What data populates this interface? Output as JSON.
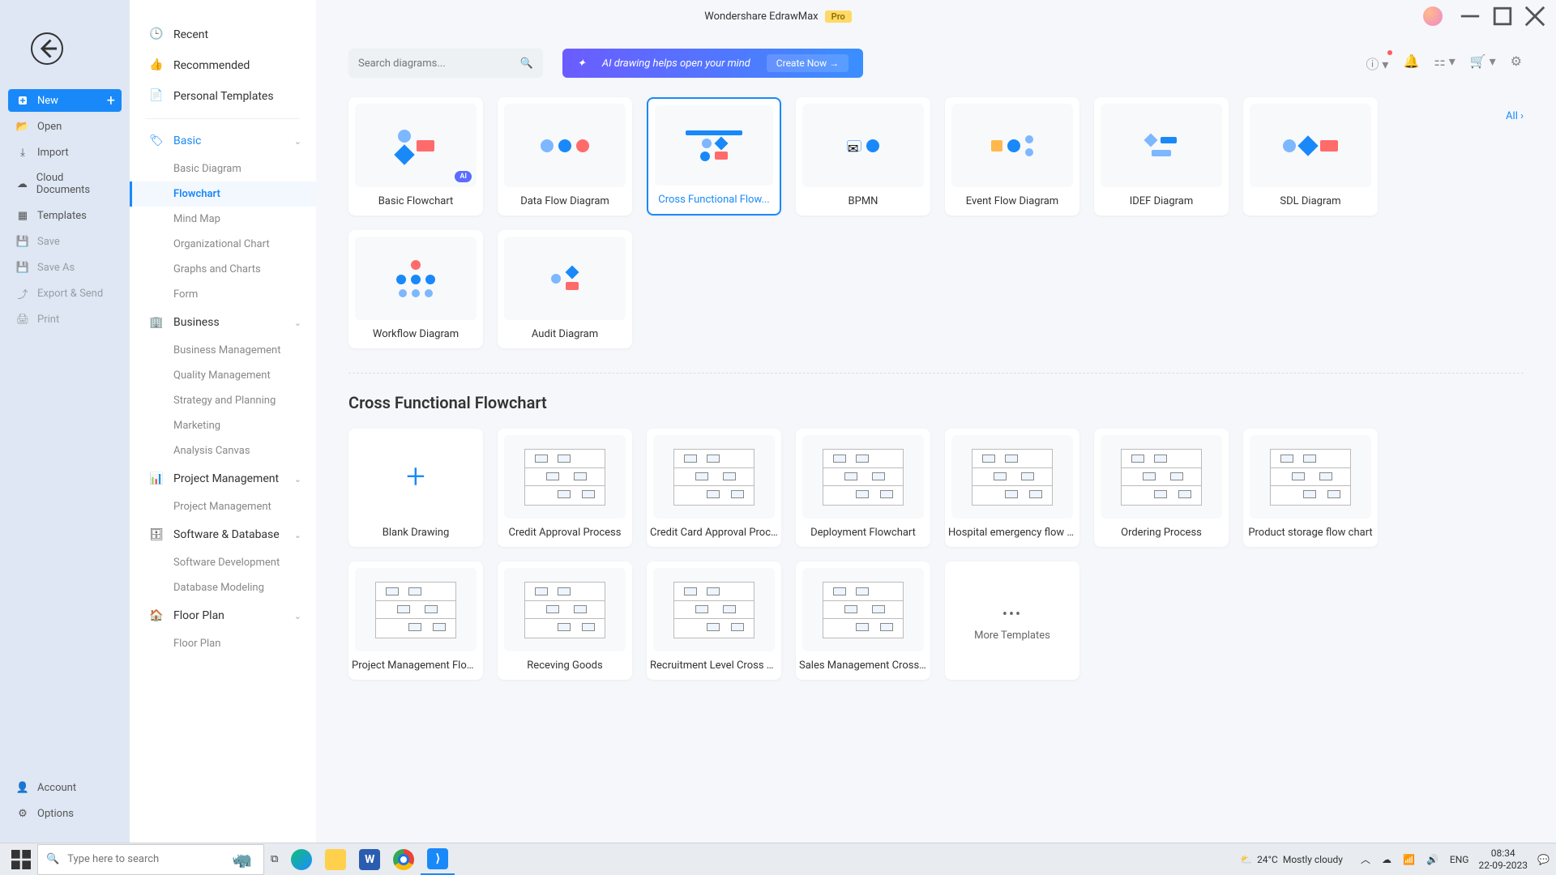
{
  "title": {
    "app": "Wondershare EdrawMax",
    "badge": "Pro"
  },
  "sidebar_left": {
    "new": "New",
    "open": "Open",
    "import": "Import",
    "cloud": "Cloud Documents",
    "templates": "Templates",
    "save": "Save",
    "save_as": "Save As",
    "export": "Export & Send",
    "print": "Print",
    "account": "Account",
    "options": "Options"
  },
  "sidebar_mid": {
    "recent": "Recent",
    "recommended": "Recommended",
    "personal": "Personal Templates",
    "basic": {
      "header": "Basic",
      "items": [
        "Basic Diagram",
        "Flowchart",
        "Mind Map",
        "Organizational Chart",
        "Graphs and Charts",
        "Form"
      ]
    },
    "business": {
      "header": "Business",
      "items": [
        "Business Management",
        "Quality Management",
        "Strategy and Planning",
        "Marketing",
        "Analysis Canvas"
      ]
    },
    "pm": {
      "header": "Project Management",
      "items": [
        "Project Management"
      ]
    },
    "sw": {
      "header": "Software & Database",
      "items": [
        "Software Development",
        "Database Modeling"
      ]
    },
    "floor": {
      "header": "Floor Plan",
      "items": [
        "Floor Plan"
      ]
    }
  },
  "search": {
    "placeholder": "Search diagrams..."
  },
  "ai_banner": {
    "text": "AI drawing helps open your mind",
    "cta": "Create Now"
  },
  "all_link": "All",
  "diagram_types": [
    {
      "label": "Basic Flowchart",
      "ai": true
    },
    {
      "label": "Data Flow Diagram"
    },
    {
      "label": "Cross Functional Flow...",
      "selected": true
    },
    {
      "label": "BPMN"
    },
    {
      "label": "Event Flow Diagram"
    },
    {
      "label": "IDEF Diagram"
    },
    {
      "label": "SDL Diagram"
    },
    {
      "label": "Workflow Diagram"
    },
    {
      "label": "Audit Diagram"
    }
  ],
  "section_title": "Cross Functional Flowchart",
  "templates": [
    {
      "label": "Blank Drawing",
      "blank": true
    },
    {
      "label": "Credit Approval Process"
    },
    {
      "label": "Credit Card Approval Proc..."
    },
    {
      "label": "Deployment Flowchart"
    },
    {
      "label": "Hospital emergency flow c..."
    },
    {
      "label": "Ordering Process"
    },
    {
      "label": "Product storage flow chart"
    },
    {
      "label": "Project Management Flow..."
    },
    {
      "label": "Receving Goods"
    },
    {
      "label": "Recruitment Level Cross F..."
    },
    {
      "label": "Sales Management Crossf..."
    },
    {
      "label": "More Templates",
      "more": true
    }
  ],
  "taskbar": {
    "search_placeholder": "Type here to search",
    "weather_temp": "24°C",
    "weather_desc": "Mostly cloudy",
    "time": "08:34",
    "date": "22-09-2023"
  }
}
